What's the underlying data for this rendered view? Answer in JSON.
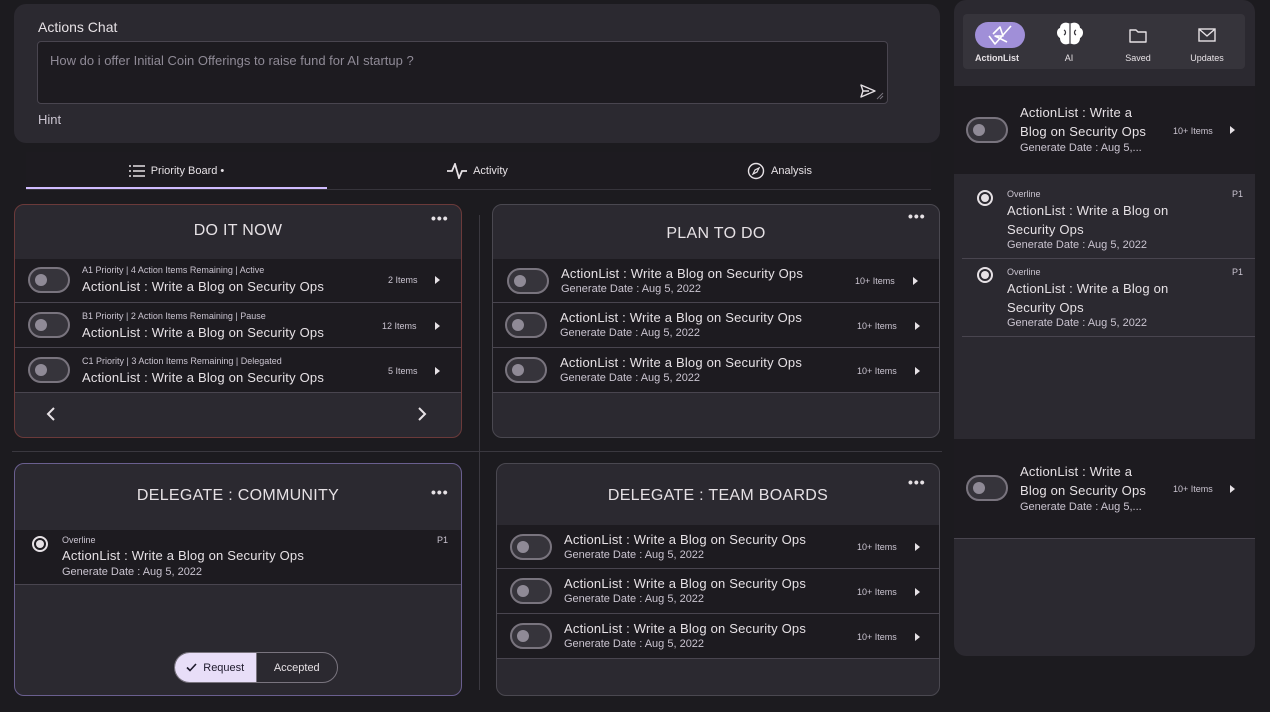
{
  "chat": {
    "title": "Actions Chat",
    "placeholder": "How do i offer Initial Coin Offerings to raise fund for AI startup ?",
    "hint": "Hint"
  },
  "tabs": [
    {
      "label": "Priority Board •",
      "icon": "list-icon",
      "active": true
    },
    {
      "label": "Activity",
      "icon": "activity-icon",
      "active": false
    },
    {
      "label": "Analysis",
      "icon": "compass-icon",
      "active": false
    }
  ],
  "do_it_now": {
    "title": "DO IT NOW",
    "rows": [
      {
        "overline": "A1 Priority | 4 Action Items Remaining | Active",
        "title": "ActionList : Write a Blog on Security Ops",
        "count": "2 Items"
      },
      {
        "overline": "B1 Priority | 2 Action Items Remaining | Pause",
        "title": "ActionList : Write a Blog on Security Ops",
        "count": "12 Items"
      },
      {
        "overline": "C1 Priority | 3 Action Items Remaining | Delegated",
        "title": "ActionList : Write a Blog on Security Ops",
        "count": "5 Items"
      }
    ]
  },
  "plan_to_do": {
    "title": "PLAN TO DO",
    "rows": [
      {
        "title": "ActionList : Write a Blog on Security Ops",
        "sub": "Generate Date : Aug 5, 2022",
        "count": "10+ Items"
      },
      {
        "title": "ActionList : Write a Blog on Security Ops",
        "sub": "Generate Date : Aug 5, 2022",
        "count": "10+ Items"
      },
      {
        "title": "ActionList : Write a Blog on Security Ops",
        "sub": "Generate Date : Aug 5, 2022",
        "count": "10+ Items"
      }
    ]
  },
  "delegate_community": {
    "title": "DELEGATE :  COMMUNITY",
    "item": {
      "overline": "Overline",
      "title": "ActionList : Write a Blog on Security Ops",
      "sub": "Generate Date : Aug 5, 2022",
      "priority": "P1"
    },
    "segments": {
      "request": "Request",
      "accepted": "Accepted"
    }
  },
  "delegate_team": {
    "title": "DELEGATE : TEAM BOARDS",
    "rows": [
      {
        "title": "ActionList : Write a Blog on Security Ops",
        "sub": "Generate Date : Aug 5, 2022",
        "count": "10+ Items"
      },
      {
        "title": "ActionList : Write a Blog on Security Ops",
        "sub": "Generate Date : Aug 5, 2022",
        "count": "10+ Items"
      },
      {
        "title": "ActionList : Write a Blog on Security Ops",
        "sub": "Generate Date : Aug 5, 2022",
        "count": "10+ Items"
      }
    ]
  },
  "sidebar": {
    "nav": [
      {
        "label": "ActionList",
        "icon": "actionlist-logo-icon",
        "active": true
      },
      {
        "label": "AI",
        "icon": "brain-icon",
        "active": false
      },
      {
        "label": "Saved",
        "icon": "folder-icon",
        "active": false
      },
      {
        "label": "Updates",
        "icon": "mail-icon",
        "active": false
      }
    ],
    "top_card": {
      "title_line1": "ActionList : Write a",
      "title_line2": "Blog on Security Ops",
      "sub": "Generate Date : Aug 5,...",
      "count": "10+ Items"
    },
    "list": [
      {
        "overline": "Overline",
        "title_line1": "ActionList : Write a Blog on",
        "title_line2": "Security Ops",
        "sub": "Generate Date : Aug 5, 2022",
        "priority": "P1"
      },
      {
        "overline": "Overline",
        "title_line1": "ActionList : Write a Blog on",
        "title_line2": "Security Ops",
        "sub": "Generate Date : Aug 5, 2022",
        "priority": "P1"
      }
    ],
    "bottom_card": {
      "title_line1": "ActionList : Write a",
      "title_line2": "Blog on Security Ops",
      "sub": "Generate Date : Aug 5,...",
      "count": "10+ Items"
    }
  },
  "colors": {
    "background": "#1c1b1f",
    "surface": "#2b2930",
    "row": "#1d1b20",
    "accent": "#d0bcff",
    "danger_border": "#6b3a3a"
  }
}
